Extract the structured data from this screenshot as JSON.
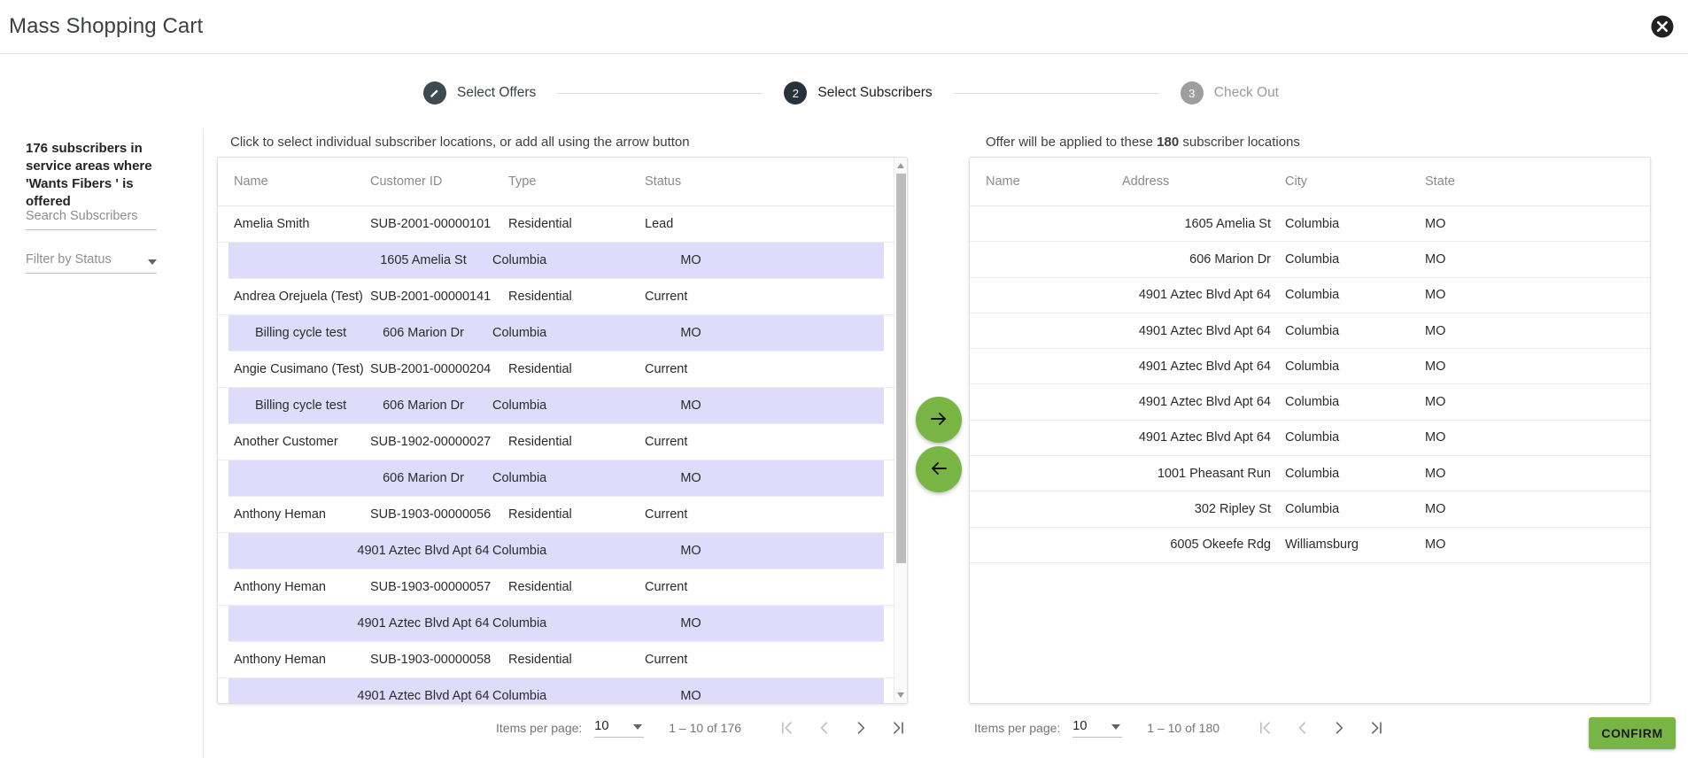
{
  "window": {
    "title": "Mass Shopping Cart",
    "close_icon": "close-circle-icon"
  },
  "stepper": {
    "steps": [
      {
        "marker": "✎",
        "label": "Select Offers",
        "state": "done"
      },
      {
        "marker": "2",
        "label": "Select Subscribers",
        "state": "active"
      },
      {
        "marker": "3",
        "label": "Check Out",
        "state": "inactive"
      }
    ]
  },
  "sidebar": {
    "heading": "176 subscribers in service areas where 'Wants Fibers ' is offered",
    "search_placeholder": "Search Subscribers",
    "filter_placeholder": "Filter by Status"
  },
  "left_panel": {
    "caption": "Click to select individual subscriber locations, or add all using the arrow button",
    "columns": [
      "Name",
      "Customer ID",
      "Type",
      "Status"
    ],
    "rows": [
      {
        "name": "Amelia Smith",
        "customer_id": "SUB-2001-00000101",
        "type": "Residential",
        "status": "Lead",
        "sub": {
          "name": "",
          "address": "1605 Amelia St",
          "city": "Columbia",
          "state": "MO"
        }
      },
      {
        "name": "Andrea Orejuela (Test)",
        "customer_id": "SUB-2001-00000141",
        "type": "Residential",
        "status": "Current",
        "sub": {
          "name": "Billing cycle test",
          "address": "606 Marion Dr",
          "city": "Columbia",
          "state": "MO"
        }
      },
      {
        "name": "Angie Cusimano (Test)",
        "customer_id": "SUB-2001-00000204",
        "type": "Residential",
        "status": "Current",
        "sub": {
          "name": "Billing cycle test",
          "address": "606 Marion Dr",
          "city": "Columbia",
          "state": "MO"
        }
      },
      {
        "name": "Another Customer",
        "customer_id": "SUB-1902-00000027",
        "type": "Residential",
        "status": "Current",
        "sub": {
          "name": "",
          "address": "606 Marion Dr",
          "city": "Columbia",
          "state": "MO"
        }
      },
      {
        "name": "Anthony Heman",
        "customer_id": "SUB-1903-00000056",
        "type": "Residential",
        "status": "Current",
        "sub": {
          "name": "",
          "address": "4901 Aztec Blvd Apt 64",
          "city": "Columbia",
          "state": "MO"
        }
      },
      {
        "name": "Anthony Heman",
        "customer_id": "SUB-1903-00000057",
        "type": "Residential",
        "status": "Current",
        "sub": {
          "name": "",
          "address": "4901 Aztec Blvd Apt 64",
          "city": "Columbia",
          "state": "MO"
        }
      },
      {
        "name": "Anthony Heman",
        "customer_id": "SUB-1903-00000058",
        "type": "Residential",
        "status": "Current",
        "sub": {
          "name": "",
          "address": "4901 Aztec Blvd Apt 64",
          "city": "Columbia",
          "state": "MO"
        }
      }
    ],
    "paginator": {
      "items_per_page_label": "Items per page:",
      "items_per_page_value": "10",
      "range": "1 – 10 of 176",
      "first_icon": "first-page-icon",
      "prev_icon": "previous-page-icon",
      "next_icon": "next-page-icon",
      "last_icon": "last-page-icon"
    }
  },
  "right_panel": {
    "caption_prefix": "Offer will be applied to these ",
    "caption_count": "180",
    "caption_suffix": " subscriber locations",
    "columns": [
      "Name",
      "Address",
      "City",
      "State"
    ],
    "rows": [
      {
        "name": "",
        "address": "1605 Amelia St",
        "city": "Columbia",
        "state": "MO"
      },
      {
        "name": "",
        "address": "606 Marion Dr",
        "city": "Columbia",
        "state": "MO"
      },
      {
        "name": "",
        "address": "4901 Aztec Blvd Apt 64",
        "city": "Columbia",
        "state": "MO"
      },
      {
        "name": "",
        "address": "4901 Aztec Blvd Apt 64",
        "city": "Columbia",
        "state": "MO"
      },
      {
        "name": "",
        "address": "4901 Aztec Blvd Apt 64",
        "city": "Columbia",
        "state": "MO"
      },
      {
        "name": "",
        "address": "4901 Aztec Blvd Apt 64",
        "city": "Columbia",
        "state": "MO"
      },
      {
        "name": "",
        "address": "4901 Aztec Blvd Apt 64",
        "city": "Columbia",
        "state": "MO"
      },
      {
        "name": "",
        "address": "1001 Pheasant Run",
        "city": "Columbia",
        "state": "MO"
      },
      {
        "name": "",
        "address": "302 Ripley St",
        "city": "Columbia",
        "state": "MO"
      },
      {
        "name": "",
        "address": "6005 Okeefe Rdg",
        "city": "Williamsburg",
        "state": "MO"
      }
    ],
    "paginator": {
      "items_per_page_label": "Items per page:",
      "items_per_page_value": "10",
      "range": "1 – 10 of 180",
      "first_icon": "first-page-icon",
      "prev_icon": "previous-page-icon",
      "next_icon": "next-page-icon",
      "last_icon": "last-page-icon"
    }
  },
  "transfer": {
    "add_icon": "arrow-right-icon",
    "remove_icon": "arrow-left-icon"
  },
  "footer": {
    "confirm_label": "CONFIRM"
  },
  "colors": {
    "accent_green": "#78b544",
    "subrow_purple": "#dedcfa",
    "step_active": "#27333a",
    "step_inactive": "#9e9e9e"
  }
}
